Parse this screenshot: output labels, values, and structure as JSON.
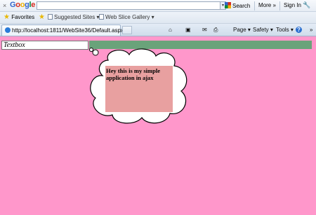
{
  "google_toolbar": {
    "close": "×",
    "logo_letters": [
      "G",
      "o",
      "o",
      "g",
      "l",
      "e"
    ],
    "search_value": "",
    "search_button": "Search",
    "more": "More »",
    "sign_in": "Sign In",
    "wrench": "🔧"
  },
  "favorites_bar": {
    "favorites": "Favorites",
    "suggested_sites": "Suggested Sites ▾",
    "web_slice_gallery": "Web Slice Gallery ▾"
  },
  "tab": {
    "url": "http://localhost:1811/WebSite36/Default.aspx"
  },
  "command_bar": {
    "page": "Page ▾",
    "safety": "Safety ▾",
    "tools": "Tools ▾",
    "help": "?",
    "chevron": "»"
  },
  "page": {
    "textbox_value": "Textbox",
    "bubble_text": "Hey this is my simple application in ajax"
  },
  "colors": {
    "page_background": "#ff97cb",
    "strip": "#6aa37a",
    "bubble_box": "#e8a0a0"
  }
}
